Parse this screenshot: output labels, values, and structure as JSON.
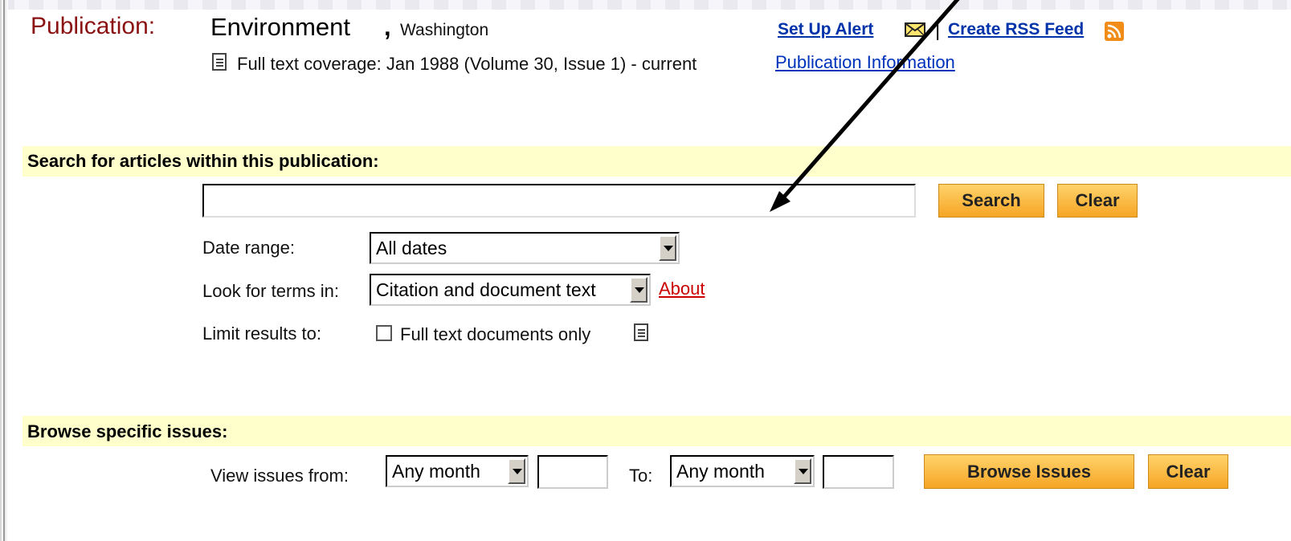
{
  "publication": {
    "label": "Publication:",
    "title": "Environment",
    "comma": ",",
    "place": "Washington",
    "coverage": "Full text coverage: Jan 1988 (Volume 30, Issue 1) - current",
    "info_link": "Publication Information"
  },
  "actions": {
    "alert_link": "Set Up Alert",
    "separator": "|",
    "rss_link": "Create RSS Feed"
  },
  "search": {
    "section_title": "Search for articles within this publication:",
    "input_value": "",
    "search_button": "Search",
    "clear_button": "Clear",
    "date_range_label": "Date range:",
    "date_range_value": "All dates",
    "terms_label": "Look for terms in:",
    "terms_value": "Citation and document text",
    "about_link": "About",
    "limit_label": "Limit results to:",
    "fulltext_only_label": "Full text documents only",
    "fulltext_only_checked": false
  },
  "browse": {
    "section_title": "Browse specific issues:",
    "from_label": "View issues from:",
    "from_month": "Any month",
    "from_year": "",
    "to_label": "To:",
    "to_month": "Any month",
    "to_year": "",
    "browse_button": "Browse Issues",
    "clear_button": "Clear"
  },
  "colors": {
    "publication_label": "#8b1212",
    "link_blue": "#0033aa",
    "band": "#ffffcc",
    "button_orange": "#f6a524",
    "about_red": "#cc0000"
  },
  "icons": [
    "document-icon",
    "envelope-icon",
    "rss-icon",
    "select-arrow-icon",
    "annotation-arrow"
  ]
}
